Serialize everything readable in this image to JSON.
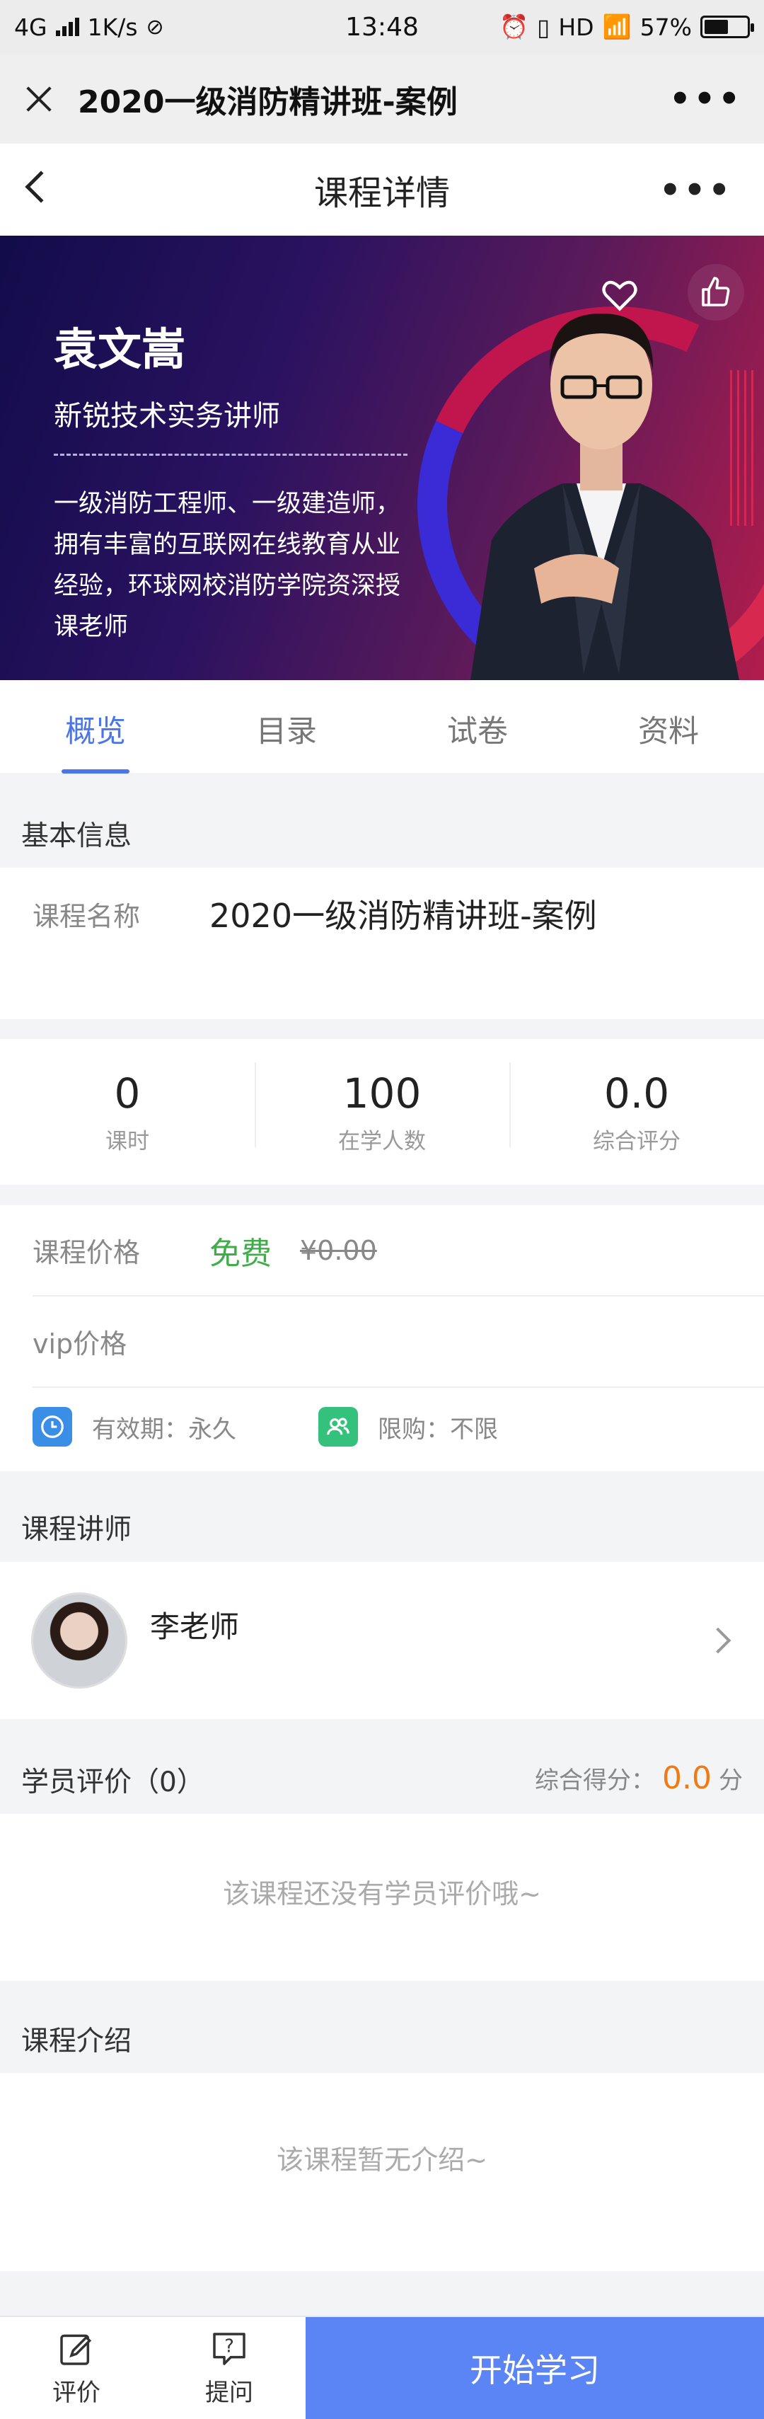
{
  "status_bar": {
    "network": "4G",
    "speed": "1K/s",
    "time": "13:48",
    "hd": "HD",
    "battery": "57%",
    "battery_level": 0.57
  },
  "mini_program": {
    "title": "2020一级消防精讲班-案例"
  },
  "header": {
    "title": "课程详情"
  },
  "banner": {
    "teacher_name": "袁文嵩",
    "teacher_role": "新锐技术实务讲师",
    "description": "一级消防工程师、一级建造师，拥有丰富的互联网在线教育从业经验，环球网校消防学院资深授课老师"
  },
  "tabs": [
    {
      "label": "概览",
      "active": true
    },
    {
      "label": "目录",
      "active": false
    },
    {
      "label": "试卷",
      "active": false
    },
    {
      "label": "资料",
      "active": false
    }
  ],
  "basic_info": {
    "section_title": "基本信息",
    "course_name_label": "课程名称",
    "course_name_value": "2020一级消防精讲班-案例"
  },
  "stats": [
    {
      "value": "0",
      "label": "课时"
    },
    {
      "value": "100",
      "label": "在学人数"
    },
    {
      "value": "0.0",
      "label": "综合评分"
    }
  ],
  "price": {
    "label": "课程价格",
    "current": "免费",
    "original": "¥0.00",
    "vip_label": "vip价格"
  },
  "meta": {
    "validity": "有效期：永久",
    "limit": "限购：不限",
    "validity_icon_color": "#3a8ee6",
    "limit_icon_color": "#34c17b"
  },
  "lecturer": {
    "section_title": "课程讲师",
    "name": "李老师"
  },
  "reviews": {
    "section_title": "学员评价（0）",
    "score_label": "综合得分：",
    "score_value": "0.0",
    "score_unit": "分",
    "empty_text": "该课程还没有学员评价哦~"
  },
  "intro": {
    "section_title": "课程介绍",
    "empty_text": "该课程暂无介绍~"
  },
  "bottom_bar": {
    "review_label": "评价",
    "ask_label": "提问",
    "start_label": "开始学习"
  },
  "colors": {
    "accent": "#4a76e8",
    "start_button": "#5b84f5",
    "free_price": "#3fae49",
    "score": "#f07a13"
  }
}
